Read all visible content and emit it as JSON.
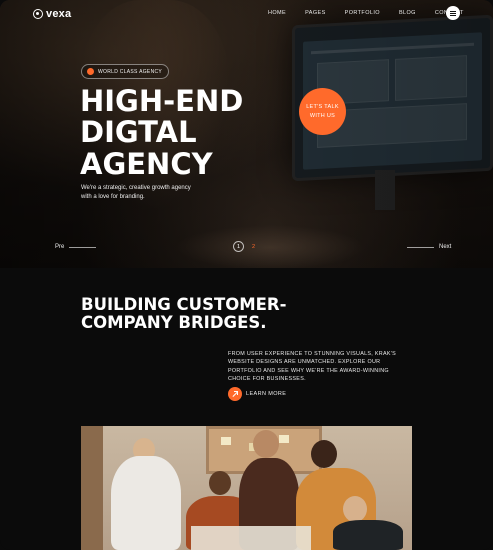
{
  "brand": {
    "name": "vexa",
    "accent": "#ff6a2b"
  },
  "nav": {
    "items": [
      "HOME",
      "PAGES",
      "PORTFOLIO",
      "BLOG",
      "CONTACT"
    ],
    "menu_icon": "hamburger-icon"
  },
  "hero": {
    "badge": "WORLD CLASS AGENCY",
    "badge_icon": "globe-icon",
    "title_lines": [
      "HIGH-END",
      "DIGTAL",
      "AGENCY"
    ],
    "subtitle": "We're a strategic, creative growth agency with a love for branding.",
    "cta": "LET'S TALK WITH US",
    "prev": "Pre",
    "next": "Next",
    "pages": [
      "1",
      "2"
    ],
    "active_page": "1"
  },
  "section": {
    "title_lines": [
      "BUILDING CUSTOMER-",
      "COMPANY BRIDGES."
    ],
    "body": "FROM USER EXPERIENCE TO STUNNING VISUALS, KRAK'S WEBSITE DESIGNS ARE UNMATCHED. EXPLORE OUR PORTFOLIO AND SEE WHY WE'RE THE AWARD-WINNING CHOICE FOR BUSINESSES.",
    "link": "LEARN MORE",
    "link_icon": "arrow-up-right-icon"
  }
}
